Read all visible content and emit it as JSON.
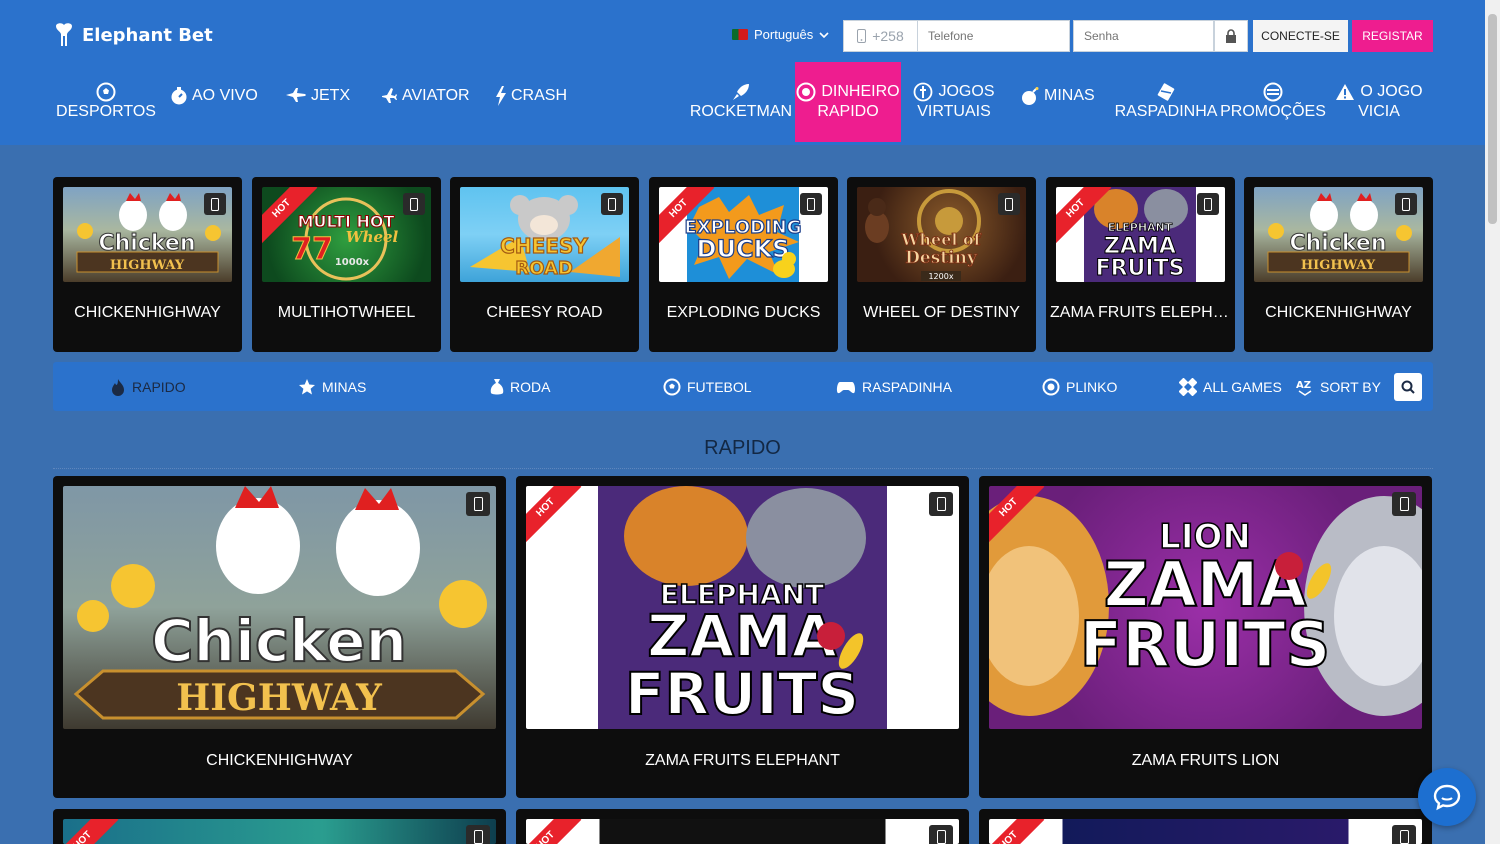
{
  "header": {
    "logo_text": "Elephant Bet",
    "language": "Português",
    "phone_prefix": "+258",
    "phone_placeholder": "Telefone",
    "password_placeholder": "Senha",
    "login_label": "CONECTE-SE",
    "register_label": "REGISTAR"
  },
  "nav": [
    {
      "label": "DESPORTOS",
      "icon": "soccer-ball-icon"
    },
    {
      "label": "AO VIVO",
      "icon": "stopwatch-icon"
    },
    {
      "label": "JETX",
      "icon": "jet-icon"
    },
    {
      "label": "AVIATOR",
      "icon": "plane-icon"
    },
    {
      "label": "CRASH",
      "icon": "lightning-icon"
    },
    {
      "label": "ROCKETMAN",
      "icon": "rocket-icon"
    },
    {
      "label1": "DINHEIRO",
      "label2": "RAPIDO",
      "icon": "coin-icon",
      "active": true
    },
    {
      "label1": "JOGOS",
      "label2": "VIRTUAIS",
      "icon": "virtual-icon"
    },
    {
      "label": "MINAS",
      "icon": "bomb-icon"
    },
    {
      "label": "RASPADINHA",
      "icon": "scratch-icon"
    },
    {
      "label": "PROMOÇÕES",
      "icon": "promo-icon"
    },
    {
      "label1": "O JOGO",
      "label2": "VICIA",
      "icon": "warning-icon"
    }
  ],
  "featured": [
    {
      "title": "CHICKENHIGHWAY",
      "hot": false
    },
    {
      "title": "MULTIHOTWHEEL",
      "hot": true
    },
    {
      "title": "CHEESY ROAD",
      "hot": false
    },
    {
      "title": "EXPLODING DUCKS",
      "hot": true
    },
    {
      "title": "WHEEL OF DESTINY",
      "hot": false
    },
    {
      "title": "ZAMA FRUITS ELEPHANT",
      "hot": true
    },
    {
      "title": "CHICKENHIGHWAY",
      "hot": false
    }
  ],
  "thumb_text": {
    "chicken1": "Chicken",
    "chicken2": "HIGHWAY",
    "multi1": "MULTI HOT",
    "multi2": "Wheel",
    "multi3": "1000x",
    "cheesy1": "CHEESY",
    "cheesy2": "ROAD",
    "ducks1": "EXPLODING",
    "ducks2": "DUCKS",
    "wheel1": "Wheel of",
    "wheel2": "Destiny",
    "wheel3": "1200x",
    "zama_el": "ELEPHANT",
    "zama1": "ZAMA",
    "zama2": "FRUITS",
    "zama_lion": "LION",
    "hot": "HOT"
  },
  "categories": [
    {
      "label": "RAPIDO",
      "icon": "fire-icon",
      "active": true
    },
    {
      "label": "MINAS",
      "icon": "star-icon"
    },
    {
      "label": "RODA",
      "icon": "money-bag-icon"
    },
    {
      "label": "FUTEBOL",
      "icon": "soccer-ball-icon"
    },
    {
      "label": "RASPADINHA",
      "icon": "gamepad-icon"
    },
    {
      "label": "PLINKO",
      "icon": "plinko-icon"
    },
    {
      "label": "ALL GAMES",
      "icon": "grid-icon"
    },
    {
      "label": "SORT BY",
      "icon": "sort-az-icon"
    }
  ],
  "section_title": "RAPIDO",
  "games": [
    {
      "title": "CHICKENHIGHWAY",
      "hot": false
    },
    {
      "title": "ZAMA FRUITS ELEPHANT",
      "hot": true
    },
    {
      "title": "ZAMA FRUITS LION",
      "hot": true
    }
  ],
  "colors": {
    "primary": "#2b72cc",
    "accent": "#ee1d8f",
    "background": "#3a6fb0",
    "card": "#0d0d0d"
  }
}
